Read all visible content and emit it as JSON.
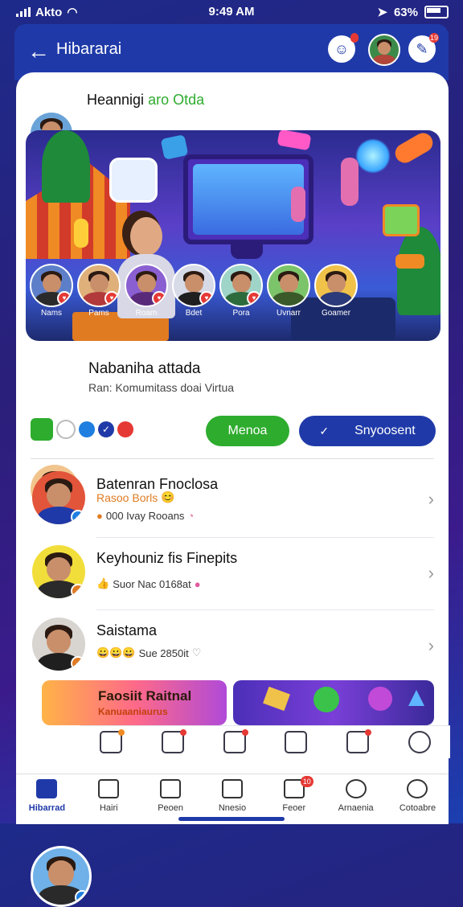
{
  "status_bar": {
    "carrier": "Akto",
    "time": "9:49 AM",
    "battery": "63%"
  },
  "header": {
    "title": "Hibararai",
    "notification_badge": "",
    "messages_badge": "19"
  },
  "top_user": {
    "title_part1": "Heannigi",
    "title_part2": "aro Otda"
  },
  "hero": {
    "people": [
      {
        "label": "Nams"
      },
      {
        "label": "Pams"
      },
      {
        "label": "Roam"
      },
      {
        "label": "Bdet"
      },
      {
        "label": "Pora"
      },
      {
        "label": "Uvnarr"
      },
      {
        "label": "Goamer"
      }
    ]
  },
  "profile": {
    "name": "Nabaniha attada",
    "subtitle": "Ran: Komumitass doai Virtua"
  },
  "actions": {
    "primary_label": "Menoa",
    "secondary_label": "Snyoosent"
  },
  "list": [
    {
      "name": "Batenran Fnoclosa",
      "tagline": "Rasoo Borls",
      "meta": "000 Ivay Rooans"
    },
    {
      "name": "Keyhouniz fis Finepits",
      "tagline": "",
      "meta": "Suor Nac 0168at"
    },
    {
      "name": "Saistama",
      "tagline": "",
      "meta": "Sue 2850it"
    }
  ],
  "promo": {
    "title": "Faosiit Raitnal",
    "subtitle": "Kanuaaniaurus"
  },
  "bottom_nav": [
    {
      "label": "Hibarrad",
      "active": true,
      "badge": ""
    },
    {
      "label": "Hairi",
      "active": false,
      "badge": ""
    },
    {
      "label": "Peoen",
      "active": false,
      "badge": ""
    },
    {
      "label": "Nnesio",
      "active": false,
      "badge": ""
    },
    {
      "label": "Feoer",
      "active": false,
      "badge": "10"
    },
    {
      "label": "Arnaenia",
      "active": false,
      "badge": ""
    },
    {
      "label": "Cotoabre",
      "active": false,
      "badge": ""
    }
  ],
  "colors": {
    "brand": "#1f3aa8",
    "green": "#2eac2e",
    "accent": "#e07b22"
  }
}
